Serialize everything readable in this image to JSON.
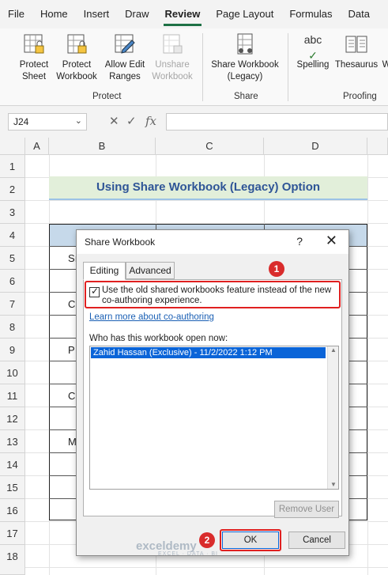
{
  "menu": [
    "File",
    "Home",
    "Insert",
    "Draw",
    "Review",
    "Page Layout",
    "Formulas",
    "Data"
  ],
  "menu_active": "Review",
  "ribbon": {
    "buttons": {
      "protect_sheet": [
        "Protect",
        "Sheet"
      ],
      "protect_workbook": [
        "Protect",
        "Workbook"
      ],
      "allow_edit": [
        "Allow Edit",
        "Ranges"
      ],
      "unshare": [
        "Unshare",
        "Workbook"
      ],
      "share_legacy": [
        "Share Workbook",
        "(Legacy)"
      ],
      "spelling": [
        "Spelling",
        ""
      ],
      "thesaurus": [
        "Thesaurus",
        ""
      ],
      "cut_w": [
        "W",
        ""
      ]
    },
    "groups": {
      "protect": "Protect",
      "share": "Share",
      "proofing": "Proofing"
    },
    "spelling_icon_text": "abc"
  },
  "formula_bar": {
    "name_box": "J24",
    "cancel": "✕",
    "enter": "✓",
    "fx": "fx",
    "value": ""
  },
  "columns": [
    "A",
    "B",
    "C",
    "D"
  ],
  "rows": [
    "1",
    "2",
    "3",
    "4",
    "5",
    "6",
    "7",
    "8",
    "9",
    "10",
    "11",
    "12",
    "13",
    "14",
    "15",
    "16",
    "17",
    "18"
  ],
  "sheet": {
    "title": "Using Share Workbook (Legacy) Option",
    "fragments": [
      {
        "row": "5",
        "text": "Sı"
      },
      {
        "row": "7",
        "text": "C"
      },
      {
        "row": "9",
        "text": "P"
      },
      {
        "row": "11",
        "text": "C"
      },
      {
        "row": "13",
        "text": "M"
      }
    ]
  },
  "dialog": {
    "title": "Share Workbook",
    "help": "?",
    "close": "✕",
    "tabs": [
      "Editing",
      "Advanced"
    ],
    "checkbox_checked": true,
    "checkbox_label": "Use the old shared workbooks feature instead of the new co-authoring experience.",
    "link": "Learn more about co-authoring",
    "who_label": "Who has this workbook open now:",
    "users": [
      "Zahid Hassan (Exclusive) - 11/2/2022 1:12 PM"
    ],
    "remove_user": "Remove User",
    "ok": "OK",
    "cancel": "Cancel"
  },
  "badges": [
    "1",
    "2"
  ],
  "watermark": {
    "name": "exceldemy",
    "tagline": "EXCEL · DATA · BI"
  },
  "colors": {
    "accent": "#1e7145",
    "title_fill": "#e2efda",
    "title_text": "#2f5597",
    "highlight": "#e02020",
    "selection": "#0a64d8"
  }
}
